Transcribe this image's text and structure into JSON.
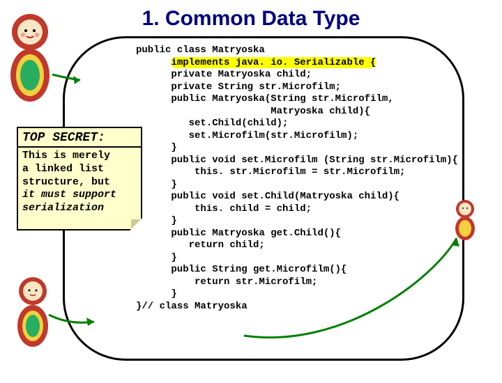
{
  "title": "1. Common Data Type",
  "code": {
    "l1": "public class Matryoska",
    "l2a": "      ",
    "l2b": "implements java. io. Serializable {",
    "l3": "      private Matryoska child;",
    "l4": "      private String str.Microfilm;",
    "l5": "      public Matryoska(String str.Microfilm,",
    "l6": "                       Matryoska child){",
    "l7": "         set.Child(child);",
    "l8": "         set.Microfilm(str.Microfilm);",
    "l9": "      }",
    "l10": "      public void set.Microfilm (String str.Microfilm){",
    "l11": "          this. str.Microfilm = str.Microfilm;",
    "l12": "      }",
    "l13": "      public void set.Child(Matryoska child){",
    "l14": "          this. child = child;",
    "l15": "      }",
    "l16": "      public Matryoska get.Child(){",
    "l17": "         return child;",
    "l18": "      }",
    "l19": "      public String get.Microfilm(){",
    "l20": "          return str.Microfilm;",
    "l21": "      }",
    "l22": "}// class Matryoska"
  },
  "note": {
    "title": "TOP SECRET:",
    "line1": "This is merely",
    "line2": " a linked list",
    "line3": "structure, but",
    "em1": "it must support",
    "em2": " serialization"
  }
}
